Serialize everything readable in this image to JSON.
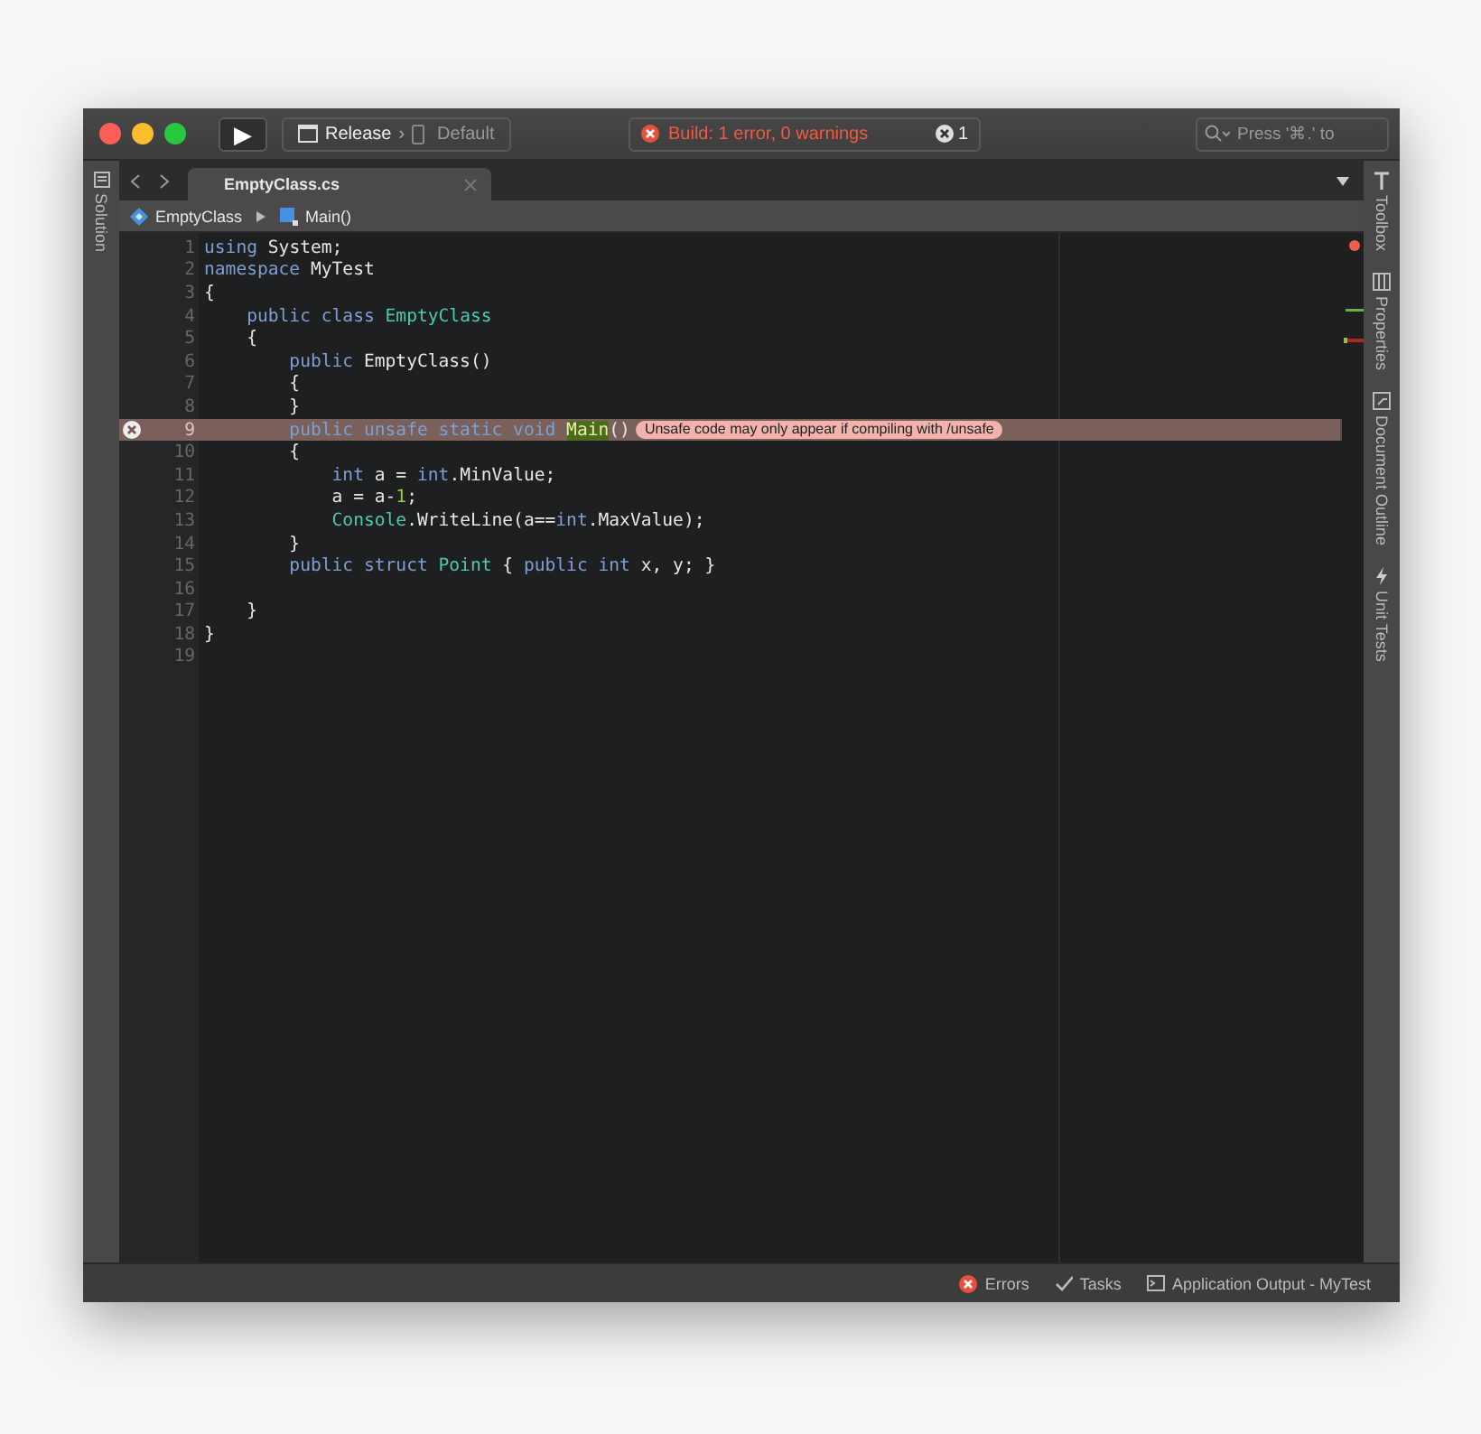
{
  "toolbar": {
    "run_label": "▶",
    "configuration": "Release",
    "separator": "›",
    "device": "Default",
    "build_status": "Build: 1 error, 0 warnings",
    "build_error_count": "1",
    "search": {
      "placeholder": "Press '⌘.' to"
    }
  },
  "left_pad": [
    {
      "label": "Solution"
    }
  ],
  "tabs": [
    {
      "label": "EmptyClass.cs",
      "selected": true
    }
  ],
  "breadcrumb": [
    {
      "label": "EmptyClass",
      "kind": "class"
    },
    {
      "label": "Main()",
      "kind": "method"
    }
  ],
  "code_lines": [
    {
      "number": "1",
      "tokens": [
        {
          "text": "using",
          "kind": "keyword"
        },
        {
          "text": " System;",
          "kind": "plain"
        }
      ]
    },
    {
      "number": "2",
      "tokens": [
        {
          "text": "namespace",
          "kind": "keyword"
        },
        {
          "text": " MyTest",
          "kind": "plain"
        }
      ]
    },
    {
      "number": "3",
      "tokens": [
        {
          "text": "{",
          "kind": "plain"
        }
      ]
    },
    {
      "number": "4",
      "tokens": [
        {
          "text": "    public class ",
          "kind": "keyword"
        },
        {
          "text": "EmptyClass",
          "kind": "type"
        }
      ]
    },
    {
      "number": "5",
      "tokens": [
        {
          "text": "    {",
          "kind": "plain"
        }
      ]
    },
    {
      "number": "6",
      "tokens": [
        {
          "text": "        public",
          "kind": "keyword"
        },
        {
          "text": " EmptyClass()",
          "kind": "plain"
        }
      ]
    },
    {
      "number": "7",
      "tokens": [
        {
          "text": "        {",
          "kind": "plain"
        }
      ]
    },
    {
      "number": "8",
      "tokens": [
        {
          "text": "        }",
          "kind": "plain"
        }
      ]
    },
    {
      "number": "9",
      "error": true,
      "message": "Unsafe code may only appear if compiling with /unsafe",
      "tokens": [
        {
          "text": "        public unsafe static void ",
          "kind": "keyword"
        },
        {
          "text": "Main",
          "kind": "highlight"
        },
        {
          "text": "()",
          "kind": "plain"
        }
      ]
    },
    {
      "number": "10",
      "tokens": [
        {
          "text": "        {",
          "kind": "plain"
        }
      ]
    },
    {
      "number": "11",
      "tokens": [
        {
          "text": "            int",
          "kind": "keyword"
        },
        {
          "text": " a = ",
          "kind": "plain"
        },
        {
          "text": "int",
          "kind": "keyword"
        },
        {
          "text": ".MinValue;",
          "kind": "plain"
        }
      ]
    },
    {
      "number": "12",
      "tokens": [
        {
          "text": "            a = a-",
          "kind": "plain"
        },
        {
          "text": "1",
          "kind": "number"
        },
        {
          "text": ";",
          "kind": "plain"
        }
      ]
    },
    {
      "number": "13",
      "tokens": [
        {
          "text": "            Console",
          "kind": "type"
        },
        {
          "text": ".WriteLine(a==",
          "kind": "plain"
        },
        {
          "text": "int",
          "kind": "keyword"
        },
        {
          "text": ".MaxValue);",
          "kind": "plain"
        }
      ]
    },
    {
      "number": "14",
      "tokens": [
        {
          "text": "        }",
          "kind": "plain"
        }
      ]
    },
    {
      "number": "15",
      "tokens": [
        {
          "text": "        public struct ",
          "kind": "keyword"
        },
        {
          "text": "Point",
          "kind": "type"
        },
        {
          "text": " { ",
          "kind": "plain"
        },
        {
          "text": "public int",
          "kind": "keyword"
        },
        {
          "text": " x, y; }",
          "kind": "plain"
        }
      ]
    },
    {
      "number": "16"
    },
    {
      "number": "17",
      "tokens": [
        {
          "text": "    }",
          "kind": "plain"
        }
      ]
    },
    {
      "number": "18",
      "tokens": [
        {
          "text": "}",
          "kind": "plain"
        }
      ]
    },
    {
      "number": "19"
    }
  ],
  "right_pad": [
    {
      "label": "Toolbox",
      "kind": "toolbox"
    },
    {
      "label": "Properties",
      "kind": "properties"
    },
    {
      "label": "Document Outline",
      "kind": "outline"
    },
    {
      "label": "Unit Tests",
      "kind": "tests"
    }
  ],
  "status_bar": [
    {
      "label": "Errors",
      "kind": "errors"
    },
    {
      "label": "Tasks",
      "kind": "tasks"
    },
    {
      "label": "Application Output - MyTest",
      "kind": "output"
    }
  ]
}
